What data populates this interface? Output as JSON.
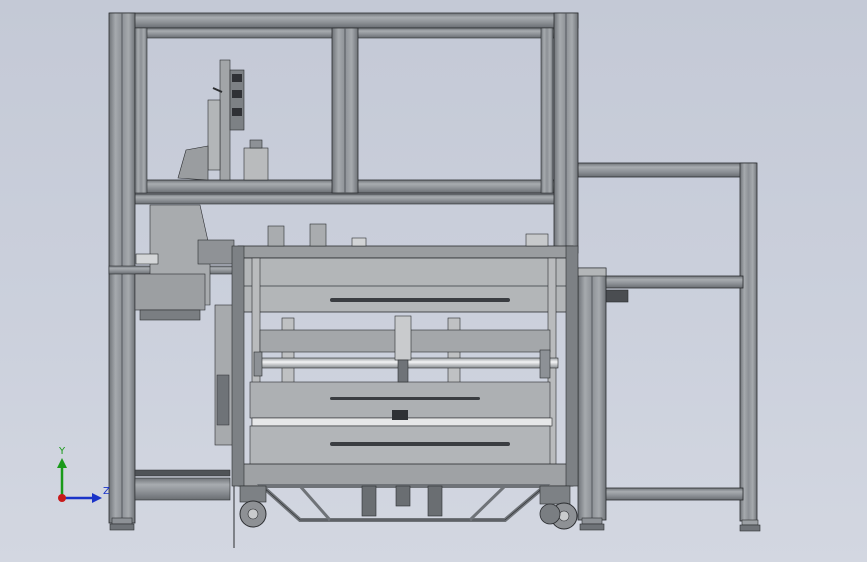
{
  "view": {
    "background_top": "#c4c9d6",
    "background_bottom": "#d3d7e1",
    "frame_color": "#8d9196",
    "frame_dark": "#55595e",
    "panel_color": "#b3b6b8",
    "edge_color": "#2b2d30"
  },
  "triad": {
    "y_label": "Y",
    "z_label": "Z",
    "y_color": "#1a9a1a",
    "z_color": "#1a33c8",
    "x_color": "#c81a1a"
  }
}
